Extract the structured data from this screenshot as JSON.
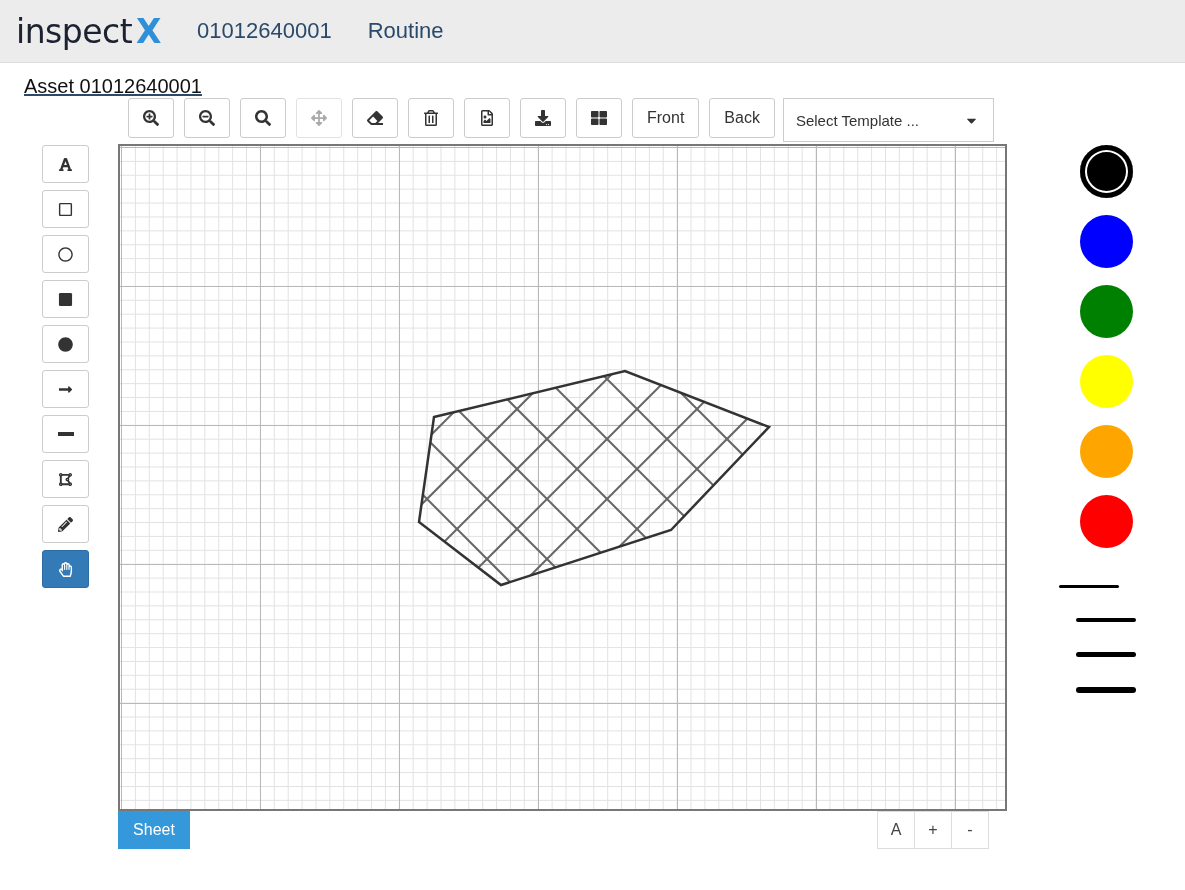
{
  "header": {
    "logo": {
      "text": "inspect",
      "accent": "X"
    },
    "asset_number": "01012640001",
    "inspection_type": "Routine"
  },
  "asset_link": "Asset 01012640001",
  "toolbar": [
    {
      "kind": "zoom-in",
      "disabled": false
    },
    {
      "kind": "zoom-out",
      "disabled": false
    },
    {
      "kind": "zoom-fit",
      "disabled": false
    },
    {
      "kind": "move",
      "disabled": true
    },
    {
      "kind": "eraser",
      "disabled": false
    },
    {
      "kind": "delete",
      "disabled": false
    },
    {
      "kind": "image",
      "disabled": false
    },
    {
      "kind": "download",
      "disabled": false
    },
    {
      "kind": "grid",
      "disabled": false
    },
    {
      "kind": "text",
      "label": "Front",
      "disabled": false
    },
    {
      "kind": "text",
      "label": "Back",
      "disabled": false
    }
  ],
  "template_select": {
    "placeholder": "Select Template ..."
  },
  "tools": [
    {
      "kind": "text",
      "selected": false
    },
    {
      "kind": "rectangle",
      "selected": false
    },
    {
      "kind": "circle",
      "selected": false
    },
    {
      "kind": "filled-rectangle",
      "selected": false
    },
    {
      "kind": "filled-circle",
      "selected": false
    },
    {
      "kind": "arrow",
      "selected": false
    },
    {
      "kind": "line",
      "selected": false
    },
    {
      "kind": "polygon",
      "selected": false
    },
    {
      "kind": "pencil",
      "selected": false
    },
    {
      "kind": "pan",
      "selected": true
    }
  ],
  "colors": [
    {
      "color": "#000000",
      "selected": true
    },
    {
      "color": "#0000ff",
      "selected": false
    },
    {
      "color": "#008000",
      "selected": false
    },
    {
      "color": "#ffff00",
      "selected": false
    },
    {
      "color": "#ffa500",
      "selected": false
    },
    {
      "color": "#ff0000",
      "selected": false
    }
  ],
  "line_widths": [
    {
      "selected": true
    },
    {
      "selected": false
    },
    {
      "selected": false
    },
    {
      "selected": false
    }
  ],
  "sheet_tab": {
    "label": "Sheet",
    "selected": true
  },
  "font_controls": [
    "A",
    "+",
    "-"
  ]
}
